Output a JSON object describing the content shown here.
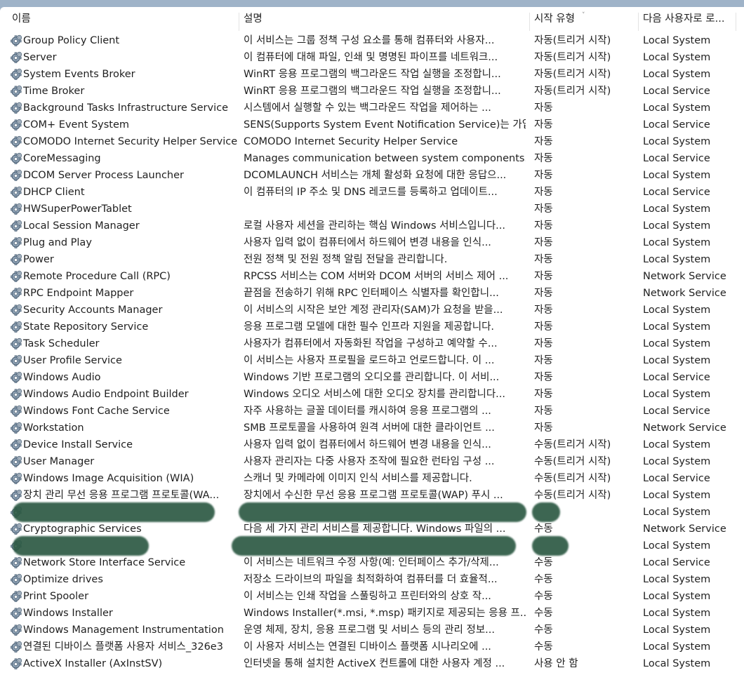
{
  "columns": {
    "name": "이름",
    "description": "설명",
    "startup_type": "시작 유형",
    "logon_as": "다음 사용자로 로..."
  },
  "sort_indicator": "chevron-down-icon",
  "colors": {
    "redaction": "#2d5a44",
    "window_background": "#9fb3c8"
  },
  "services": [
    {
      "name": "Group Policy Client",
      "description": "이 서비스는 그룹 정책 구성 요소를 통해 컴퓨터와 사용자...",
      "startup": "자동(트리거 시작)",
      "logon": "Local System"
    },
    {
      "name": "Server",
      "description": "이 컴퓨터에 대해 파일, 인쇄 및 명명된 파이프를 네트워크...",
      "startup": "자동(트리거 시작)",
      "logon": "Local System"
    },
    {
      "name": "System Events Broker",
      "description": "WinRT 응용 프로그램의 백그라운드 작업 실행을 조정합니...",
      "startup": "자동(트리거 시작)",
      "logon": "Local System"
    },
    {
      "name": "Time Broker",
      "description": "WinRT 응용 프로그램의 백그라운드 작업 실행을 조정합니...",
      "startup": "자동(트리거 시작)",
      "logon": "Local Service"
    },
    {
      "name": "Background Tasks Infrastructure Service",
      "description": "시스템에서 실행할 수 있는 백그라운드 작업을 제어하는 ...",
      "startup": "자동",
      "logon": "Local System"
    },
    {
      "name": "COM+ Event System",
      "description": "SENS(Supports System Event Notification Service)는 가입...",
      "startup": "자동",
      "logon": "Local Service"
    },
    {
      "name": "COMODO Internet Security Helper Service",
      "description": "COMODO Internet Security Helper Service",
      "startup": "자동",
      "logon": "Local System"
    },
    {
      "name": "CoreMessaging",
      "description": "Manages communication between system components.",
      "startup": "자동",
      "logon": "Local Service"
    },
    {
      "name": "DCOM Server Process Launcher",
      "description": "DCOMLAUNCH 서비스는 개체 활성화 요청에 대한 응답으...",
      "startup": "자동",
      "logon": "Local System"
    },
    {
      "name": "DHCP Client",
      "description": "이 컴퓨터의 IP 주소 및 DNS 레코드를 등록하고 업데이트...",
      "startup": "자동",
      "logon": "Local Service"
    },
    {
      "name": "HWSuperPowerTablet",
      "description": "",
      "startup": "자동",
      "logon": "Local System"
    },
    {
      "name": "Local Session Manager",
      "description": "로컬 사용자 세션을 관리하는 핵심 Windows 서비스입니다...",
      "startup": "자동",
      "logon": "Local System"
    },
    {
      "name": "Plug and Play",
      "description": "사용자 입력 없이 컴퓨터에서 하드웨어 변경 내용을 인식...",
      "startup": "자동",
      "logon": "Local System"
    },
    {
      "name": "Power",
      "description": "전원 정책 및 전원 정책 알림 전달을 관리합니다.",
      "startup": "자동",
      "logon": "Local System"
    },
    {
      "name": "Remote Procedure Call (RPC)",
      "description": "RPCSS 서비스는 COM 서버와 DCOM 서버의 서비스 제어 ...",
      "startup": "자동",
      "logon": "Network Service"
    },
    {
      "name": "RPC Endpoint Mapper",
      "description": "끝점을 전송하기 위해 RPC 인터페이스 식별자를 확인합니...",
      "startup": "자동",
      "logon": "Network Service"
    },
    {
      "name": "Security Accounts Manager",
      "description": "이 서비스의 시작은 보안 계정 관리자(SAM)가 요청을 받을...",
      "startup": "자동",
      "logon": "Local System"
    },
    {
      "name": "State Repository Service",
      "description": "응용 프로그램 모델에 대한 필수 인프라 지원을 제공합니다.",
      "startup": "자동",
      "logon": "Local System"
    },
    {
      "name": "Task Scheduler",
      "description": "사용자가 컴퓨터에서 자동화된 작업을 구성하고 예약할 수...",
      "startup": "자동",
      "logon": "Local System"
    },
    {
      "name": "User Profile Service",
      "description": "이 서비스는 사용자 프로필을 로드하고 언로드합니다. 이 ...",
      "startup": "자동",
      "logon": "Local System"
    },
    {
      "name": "Windows Audio",
      "description": "Windows 기반 프로그램의 오디오를 관리합니다. 이 서비...",
      "startup": "자동",
      "logon": "Local Service"
    },
    {
      "name": "Windows Audio Endpoint Builder",
      "description": "Windows 오디오 서비스에 대한 오디오 장치를 관리합니다...",
      "startup": "자동",
      "logon": "Local System"
    },
    {
      "name": "Windows Font Cache Service",
      "description": "자주 사용하는 글꼴 데이터를 캐시하여 응용 프로그램의 ...",
      "startup": "자동",
      "logon": "Local Service"
    },
    {
      "name": "Workstation",
      "description": "SMB 프로토콜을 사용하여 원격 서버에 대한 클라이언트 ...",
      "startup": "자동",
      "logon": "Network Service"
    },
    {
      "name": "Device Install Service",
      "description": "사용자 입력 없이 컴퓨터에서 하드웨어 변경 내용을 인식...",
      "startup": "수동(트리거 시작)",
      "logon": "Local System"
    },
    {
      "name": "User Manager",
      "description": "사용자 관리자는 다중 사용자 조작에 필요한 런타임 구성 ...",
      "startup": "수동(트리거 시작)",
      "logon": "Local System"
    },
    {
      "name": "Windows Image Acquisition (WIA)",
      "description": "스캐너 및 카메라에 이미지 인식 서비스를 제공합니다.",
      "startup": "수동(트리거 시작)",
      "logon": "Local Service"
    },
    {
      "name": "장치 관리 무선 응용 프로그램 프로토콜(WA...",
      "description": "장치에서 수신한 무선 응용 프로그램 프로토콜(WAP) 푸시 ...",
      "startup": "수동(트리거 시작)",
      "logon": "Local System"
    },
    {
      "name": "",
      "description": "",
      "startup": "",
      "logon": "Local System",
      "redacted": true
    },
    {
      "name": "Cryptographic Services",
      "description": "다음 세 가지 관리 서비스를 제공합니다. Windows 파일의 ...",
      "startup": "수동",
      "logon": "Network Service"
    },
    {
      "name": "",
      "description": "",
      "startup": "",
      "logon": "Local System",
      "redacted": true
    },
    {
      "name": "Network Store Interface Service",
      "description": "이 서비스는 네트워크 수정 사항(예: 인터페이스 추가/삭제...",
      "startup": "수동",
      "logon": "Local Service"
    },
    {
      "name": "Optimize drives",
      "description": "저장소 드라이브의 파일을 최적화하여 컴퓨터를 더 효율적...",
      "startup": "수동",
      "logon": "Local System"
    },
    {
      "name": "Print Spooler",
      "description": "이 서비스는 인쇄 작업을 스풀링하고 프린터와의 상호 작...",
      "startup": "수동",
      "logon": "Local System"
    },
    {
      "name": "Windows Installer",
      "description": "Windows Installer(*.msi, *.msp) 패키지로 제공되는 응용 프...",
      "startup": "수동",
      "logon": "Local System"
    },
    {
      "name": "Windows Management Instrumentation",
      "description": "운영 체제, 장치, 응용 프로그램 및 서비스 등의 관리 정보...",
      "startup": "수동",
      "logon": "Local System"
    },
    {
      "name": "연결된 디바이스 플랫폼 사용자 서비스_326e3",
      "description": "이 사용자 서비스는 연결된 디바이스 플랫폼 시나리오에 ...",
      "startup": "수동",
      "logon": "Local System"
    },
    {
      "name": "ActiveX Installer (AxInstSV)",
      "description": "인터넷을 통해 설치한 ActiveX 컨트롤에 대한 사용자 계정 ...",
      "startup": "사용 안 함",
      "logon": "Local System"
    }
  ]
}
